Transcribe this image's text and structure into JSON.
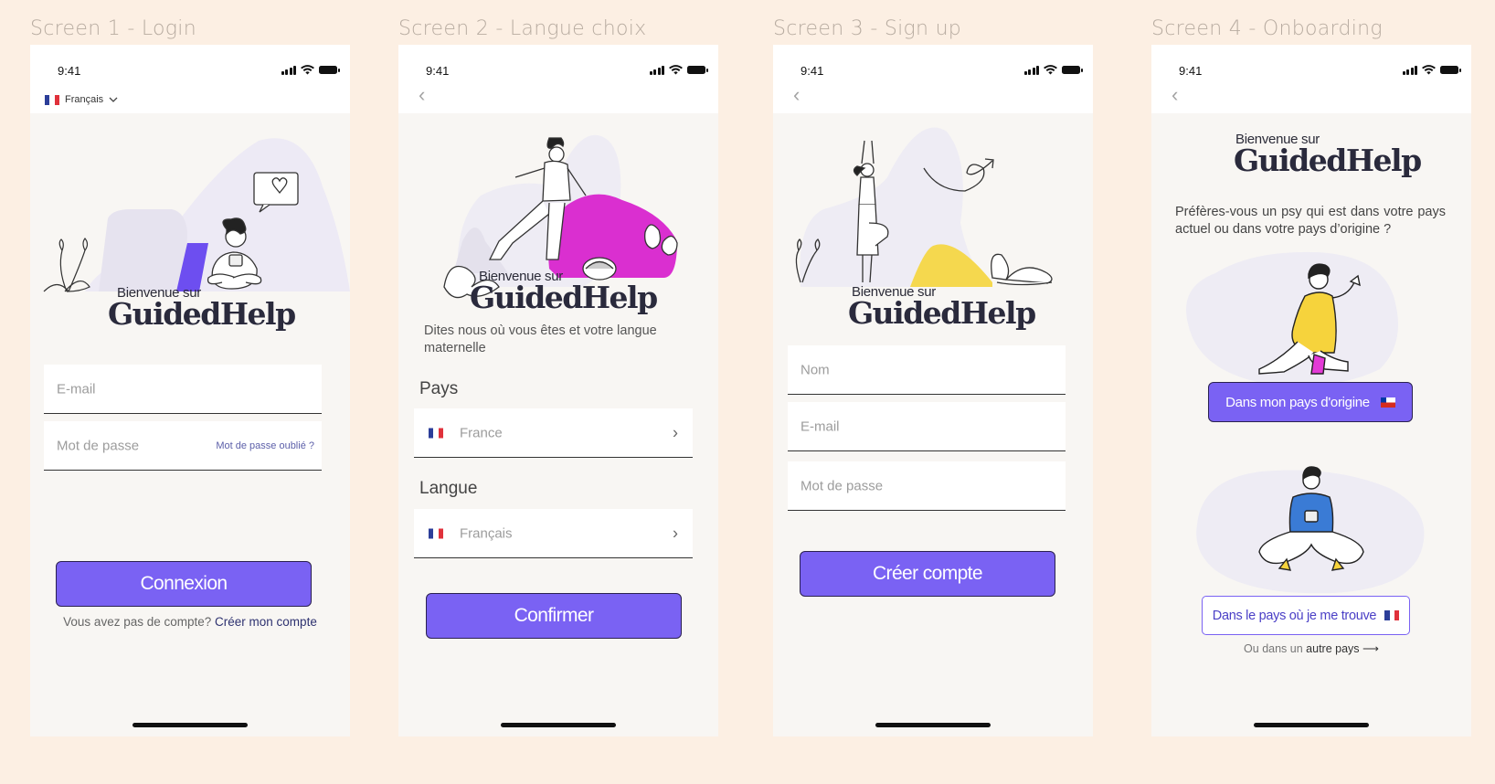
{
  "screens": [
    {
      "title": "Screen 1 - Login"
    },
    {
      "title": "Screen 2 - Langue choix"
    },
    {
      "title": "Screen 3 - Sign up"
    },
    {
      "title": "Screen 4 - Onboarding"
    }
  ],
  "status": {
    "time": "9:41"
  },
  "brand": {
    "welcome": "Bienvenue sur",
    "name_part1": "Guided",
    "name_part2": "Help"
  },
  "login": {
    "language_selector": "Français",
    "email_placeholder": "E-mail",
    "password_placeholder": "Mot de passe",
    "forgot_password": "Mot de passe oublié ?",
    "submit_label": "Connexion",
    "no_account_text": "Vous avez pas de compte?",
    "create_account_link": "Créer mon compte"
  },
  "language_choice": {
    "intro": "Dites nous où vous êtes et votre langue maternelle",
    "country_label": "Pays",
    "country_value": "France",
    "language_label": "Langue",
    "language_value": "Français",
    "submit_label": "Confirmer"
  },
  "signup": {
    "name_placeholder": "Nom",
    "email_placeholder": "E-mail",
    "password_placeholder": "Mot de passe",
    "submit_label": "Créer compte"
  },
  "onboarding": {
    "question": "Préfères-vous un psy qui est dans votre pays actuel ou dans votre pays d’origine ?",
    "origin_button": "Dans mon pays d'origine",
    "current_button": "Dans le pays où je me trouve",
    "other_prefix": "Ou dans un",
    "other_link": "autre pays"
  },
  "colors": {
    "background": "#fcefe3",
    "primary": "#7a62f3",
    "highlight": "#7fc0a8",
    "magenta": "#d930c9",
    "yellow": "#f5d84e"
  }
}
